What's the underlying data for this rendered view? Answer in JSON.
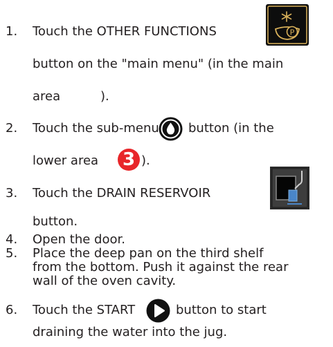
{
  "steps": [
    {
      "num": "1.",
      "pre": "Touch the OTHER FUNCTIONS",
      "line2": "button on the \"main menu\" (in the main",
      "line3a": "area",
      "line3b": ")."
    },
    {
      "num": "2.",
      "pre": "Touch the sub-menu",
      "post": "button (in the",
      "line2a": "lower area",
      "badge": "3",
      "line2b": ")."
    },
    {
      "num": "3.",
      "pre": "Touch the DRAIN RESERVOIR",
      "line2": "button."
    },
    {
      "num": "4.",
      "text": "Open the door."
    },
    {
      "num": "5.",
      "lines": [
        "Place the deep pan on the third shelf",
        "from the bottom. Push it against the rear",
        "wall of the oven cavity."
      ]
    },
    {
      "num": "6.",
      "pre": "Touch the START",
      "post": "button to start",
      "line2": "draining the water into the jug."
    }
  ],
  "icons": {
    "other_functions": "other-functions-icon",
    "water_drop": "water-drop-icon",
    "drain_reservoir": "drain-reservoir-icon",
    "start": "start-play-icon"
  },
  "colors": {
    "badge": "#e8262a",
    "gold": "#d9b15a",
    "text": "#231f20"
  }
}
